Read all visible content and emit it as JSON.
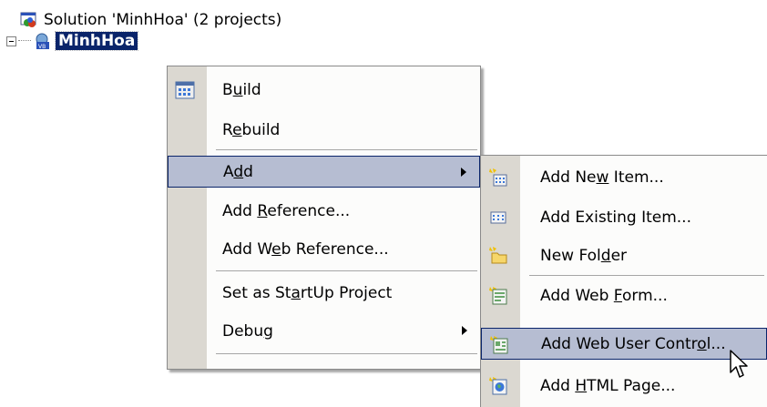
{
  "solution": {
    "label": "Solution 'MinhHoa' (2 projects)"
  },
  "project": {
    "label": "MinhHoa"
  },
  "context_menu": {
    "items": [
      {
        "pre": "B",
        "acc": "u",
        "post": "ild",
        "icon": "build-icon"
      },
      {
        "pre": "R",
        "acc": "e",
        "post": "build"
      },
      {
        "pre": "A",
        "acc": "d",
        "post": "d",
        "submenu": true,
        "highlighted": true
      },
      {
        "pre": "Add ",
        "acc": "R",
        "post": "eference..."
      },
      {
        "pre": "Add W",
        "acc": "e",
        "post": "b Reference..."
      },
      {
        "pre": "Set as St",
        "acc": "a",
        "post": "rtUp Project"
      },
      {
        "pre": "Debu",
        "acc": "g",
        "post": "",
        "submenu": true
      }
    ]
  },
  "add_submenu": {
    "items": [
      {
        "pre": "Add Ne",
        "acc": "w",
        "post": " Item...",
        "icon": "add-new-item-icon"
      },
      {
        "pre": "Add Existin",
        "acc": "g",
        "post": " Item...",
        "icon": "add-existing-item-icon"
      },
      {
        "pre": "New Fol",
        "acc": "d",
        "post": "er",
        "icon": "new-folder-icon"
      },
      {
        "pre": "Add Web ",
        "acc": "F",
        "post": "orm...",
        "icon": "add-web-form-icon"
      },
      {
        "pre": "Add Web User Contr",
        "acc": "o",
        "post": "l...",
        "icon": "add-web-user-control-icon",
        "highlighted": true
      },
      {
        "pre": "Add ",
        "acc": "H",
        "post": "TML Page...",
        "icon": "add-html-page-icon"
      }
    ]
  }
}
